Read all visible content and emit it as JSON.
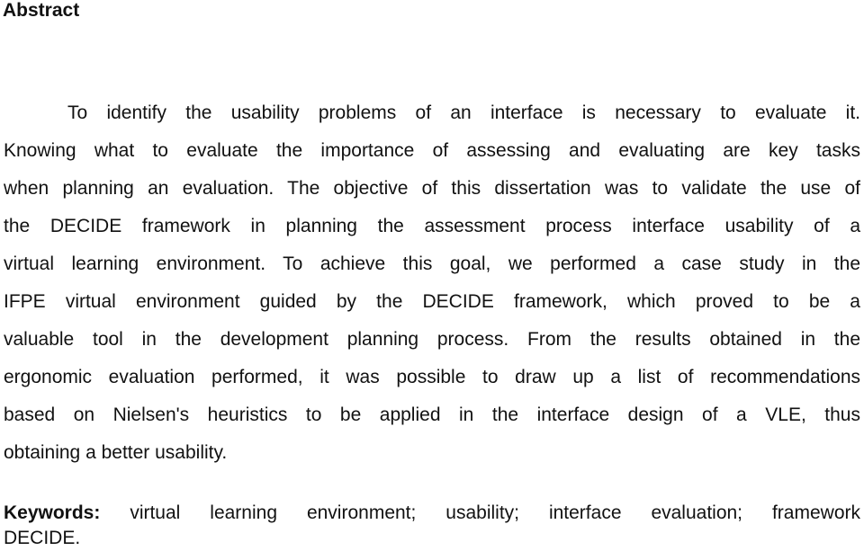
{
  "heading": "Abstract",
  "abstract_lines": [
    "To identify the usability problems of an interface is necessary to evaluate it.",
    "Knowing what to evaluate the importance of assessing and evaluating are key tasks",
    "when planning an evaluation. The objective of this dissertation was to validate the use of",
    "the DECIDE framework in planning the assessment process interface usability of a",
    "virtual learning environment. To achieve this goal, we performed a case study in the",
    "IFPE virtual environment guided by the DECIDE framework, which proved to be a",
    "valuable tool in the development planning process. From the results obtained in the",
    "ergonomic evaluation performed, it was possible to draw up a list of recommendations",
    "based on Nielsen's heuristics to be applied in the interface design of a VLE, thus",
    "obtaining a better usability."
  ],
  "keywords": {
    "label": "Keywords:",
    "line1": "virtual learning environment; usability; interface evaluation; framework",
    "line2": "DECIDE."
  }
}
